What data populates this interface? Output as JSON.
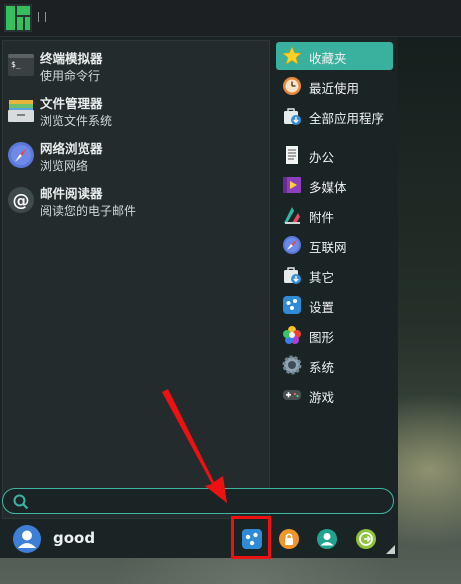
{
  "apps": [
    {
      "name": "终端模拟器",
      "desc": "使用命令行",
      "icon": "terminal-icon"
    },
    {
      "name": "文件管理器",
      "desc": "浏览文件系统",
      "icon": "file-manager-icon"
    },
    {
      "name": "网络浏览器",
      "desc": "浏览网络",
      "icon": "compass-icon"
    },
    {
      "name": "邮件阅读器",
      "desc": "阅读您的电子邮件",
      "icon": "at-sign-icon"
    }
  ],
  "categories": [
    {
      "label": "收藏夹",
      "icon": "star-icon",
      "selected": true
    },
    {
      "label": "最近使用",
      "icon": "clock-icon",
      "selected": false
    },
    {
      "label": "全部应用程序",
      "icon": "bag-download-icon",
      "selected": false
    },
    {
      "label": "办公",
      "icon": "document-icon",
      "selected": false
    },
    {
      "label": "多媒体",
      "icon": "media-icon",
      "selected": false
    },
    {
      "label": "附件",
      "icon": "accessories-icon",
      "selected": false
    },
    {
      "label": "互联网",
      "icon": "compass-icon",
      "selected": false
    },
    {
      "label": "其它",
      "icon": "bag-download-icon",
      "selected": false
    },
    {
      "label": "设置",
      "icon": "settings-icon",
      "selected": false
    },
    {
      "label": "图形",
      "icon": "color-wheel-icon",
      "selected": false
    },
    {
      "label": "系统",
      "icon": "gear-icon",
      "selected": false
    },
    {
      "label": "游戏",
      "icon": "gamepad-icon",
      "selected": false
    }
  ],
  "search": {
    "value": "",
    "placeholder": ""
  },
  "user": {
    "name": "good"
  },
  "bottom_buttons": [
    {
      "name": "settings-button",
      "icon": "settings-icon"
    },
    {
      "name": "lock-screen-button",
      "icon": "lock-icon"
    },
    {
      "name": "switch-user-button",
      "icon": "user-icon"
    },
    {
      "name": "logout-button",
      "icon": "logout-icon"
    }
  ],
  "colors": {
    "accent": "#3ab09e",
    "highlight": "#ee1111",
    "brand": "#35bf5c"
  }
}
